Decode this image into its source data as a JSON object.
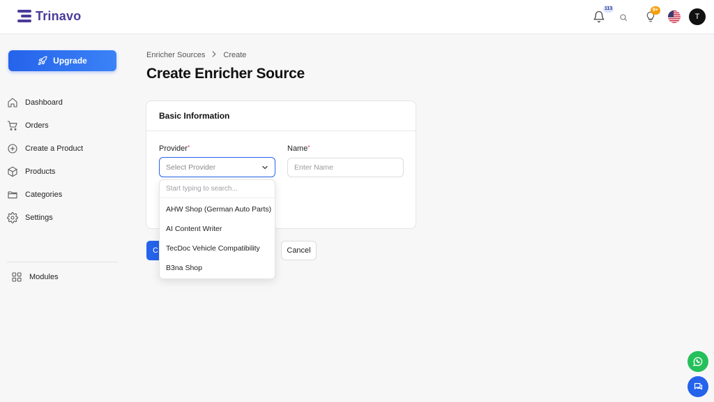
{
  "app": {
    "brand": "Trinavo"
  },
  "header": {
    "notifications_badge": "113",
    "tips_badge": "9+",
    "avatar_initial": "T",
    "colors": {
      "notification_badge_bg": "#dbe3ff",
      "tips_badge_bg": "#f59e0b"
    }
  },
  "sidebar": {
    "upgrade_label": "Upgrade",
    "items": [
      {
        "label": "Dashboard",
        "icon": "home-icon"
      },
      {
        "label": "Orders",
        "icon": "cart-icon"
      },
      {
        "label": "Create a Product",
        "icon": "plus-circle-icon"
      },
      {
        "label": "Products",
        "icon": "box-icon"
      },
      {
        "label": "Categories",
        "icon": "folder-icon"
      },
      {
        "label": "Settings",
        "icon": "gear-icon"
      }
    ],
    "modules_label": "Modules"
  },
  "breadcrumb": {
    "parent": "Enricher Sources",
    "current": "Create"
  },
  "page": {
    "title": "Create Enricher Source"
  },
  "form": {
    "section_title": "Basic Information",
    "provider_label": "Provider",
    "provider_placeholder": "Select Provider",
    "name_label": "Name",
    "name_placeholder": "Enter Name",
    "required_mark": "*",
    "submit_label_visible": "C",
    "cancel_label": "Cancel"
  },
  "dropdown": {
    "search_placeholder": "Start typing to search...",
    "options": [
      "AHW Shop (German Auto Parts)",
      "AI Content Writer",
      "TecDoc Vehicle Compatibility",
      "B3na Shop"
    ]
  },
  "colors": {
    "accent": "#2563eb",
    "brand": "#4b3a9a",
    "whatsapp": "#25c05a"
  }
}
